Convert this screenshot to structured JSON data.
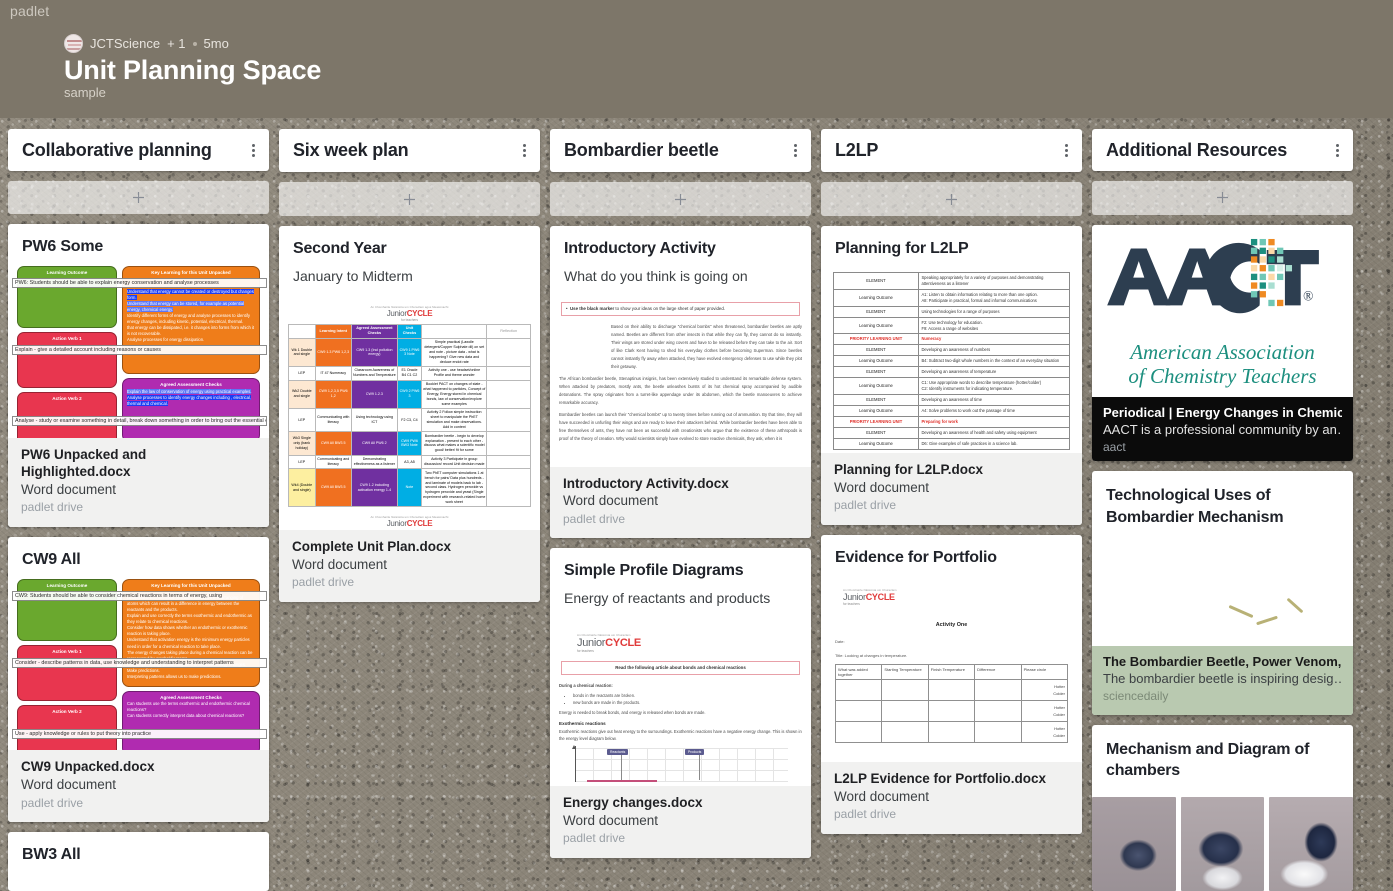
{
  "brand": "padlet",
  "header": {
    "author": "JCTScience",
    "collaborators": "+ 1",
    "age": "5mo",
    "title": "Unit Planning Space",
    "subtitle": "sample",
    "avatar_icon": "avatar-icon"
  },
  "add_icon": "plus-icon",
  "kebab_icon": "more-options-icon",
  "columns": [
    {
      "title": "Collaborative planning",
      "cards": [
        {
          "subject": "PW6 Some",
          "attachment": {
            "name": "PW6 Unpacked and Highlighted.docx",
            "type": "Word document",
            "source": "padlet drive"
          },
          "preview": {
            "kind": "unpacked",
            "learning_outcome_header": "Learning Outcome",
            "key_learning_header": "Key Learning for this Unit Unpacked",
            "action_verb_1_header": "Action Verb 1",
            "action_verb_2_header": "Action Verb 2",
            "assessment_header": "Agreed Assessment Checks",
            "outcome_line": "PW6: Students should be able to explain energy conservation and analyse processes",
            "verb1_line": "Explain - give a detailed account including reasons or causes",
            "verb2_line": "Analyse - study or examine something in detail, break down something in order to bring out the essential elements",
            "key_points": [
              "Understand that energy cannot be created or destroyed but changes form.",
              "Understand that energy can be stored, for example as potential energy, chemical energy.",
              "Identify different forms of energy and analyse processes to identify energy changes, including kinetic, potential, electrical, thermal.",
              "that energy can be dissipated, i.e. it changes into forms from which it is not recoverable.",
              "Analyse processes for energy dissipation."
            ],
            "assessment_points": [
              "Explain the law of conservation of energy using practical examples.",
              "Analyse processes to identify energy changes including , electrical, thermal and chemical."
            ]
          }
        },
        {
          "subject": "CW9 All",
          "attachment": {
            "name": "CW9 Unpacked.docx",
            "type": "Word document",
            "source": "padlet drive"
          },
          "preview": {
            "kind": "unpacked",
            "learning_outcome_header": "Learning Outcome",
            "key_learning_header": "Key Learning for this Unit Unpacked",
            "action_verb_1_header": "Action Verb 1",
            "action_verb_2_header": "Action Verb 2",
            "assessment_header": "Agreed Assessment Checks",
            "outcome_line": "CW9: Students should be able to consider chemical reactions in terms of energy, using",
            "verb1_line": "Consider - describe patterns in data, use knowledge and understanding to interpret patterns",
            "verb2_line": "Use - apply knowledge or rules to put theory into practice",
            "key_points": [
              "Understand that chemical reactions involves the rearranging of atoms which can result in a difference in energy between the reactants and the products.",
              "Explain and use correctly the terms exothermic and endothermic as they relate to chemical reactions.",
              "Consider how data shows whether an endothermic or exothermic reaction is taking place.",
              "Understand that activation energy is the minimum energy particles need in order for a chemical reaction to take place.",
              "The energy changes taking place during a chemical reaction can be represented by graphs/diagrams.",
              "Use simple energy profile diagrams to illustrate energy changes.",
              "Make predictions.",
              "Interpreting patterns allows us to make predictions."
            ],
            "assessment_points": [
              "Can students use the terms exothermic and endothermic chemical reactions?",
              "Can students correctly interpret data about chemical reactions?"
            ]
          }
        },
        {
          "subject": "BW3 All",
          "attachment": null,
          "preview": {
            "kind": "none"
          }
        }
      ]
    },
    {
      "title": "Six week plan",
      "cards": [
        {
          "subject": "Second Year",
          "body": "January to Midterm",
          "attachment": {
            "name": "Complete Unit Plan.docx",
            "type": "Word document",
            "source": "padlet drive"
          },
          "preview": {
            "kind": "unit-plan-table",
            "logo_caption": "An Chomhairle Náisiúnta um Churaclam agus Measúnacht",
            "logo_mark_a": "Junior",
            "logo_mark_b": "CYCLE",
            "logo_sub": "for teachers",
            "headers": [
              "",
              "Learning Intent",
              "Agreed Assessment Checks",
              "Unit Checks",
              "",
              "Reflection"
            ],
            "rows": [
              [
                "Wk 1 Double and single",
                "CW9 1.3 PW6 1,2,3",
                "CW9 1.3 (Incl pollution energy)",
                "CW9 1 PW6 3 Note",
                "Simple practical (Lawdle detergent/Copper Sulphate dil) on set and note - picture data - what is happening? Give new data and deduce endot rate",
                ""
              ],
              [
                "LEP",
                "IT 47 Numeracy",
                "Classroom Awareness of Numbers and Temperature",
                "E1 Oracle B4 C1 C2",
                "Activity one - use headset/online Profile and theme wonder",
                ""
              ],
              [
                "Wk2 Double and single",
                "CW9 1,2,3,5 PW6 1,2",
                "CW9 1.2.3",
                "CW9 2 PW6 3",
                "Booklet PACT on changes of state - what happened to particles, Concept of Energy, Energy stored in chemical bonds, law of conservation/explore some examples",
                ""
              ],
              [
                "LEP",
                "Communicating with literacy",
                "Using technology using ICT",
                "F2 C3, C4",
                "Activity 2 Follow simple instruction sheet to manipulate the PhET simulation and make observations. Add in context",
                ""
              ],
              [
                "Wk3 Single only (bank holiday)",
                "CW9 All BW3 5",
                "CW9 All PW6 2",
                "CW9 PW6 BW3 Note",
                "Bombardier beetle - begin to develop explanation - present to each other - discuss what makes a scientific model good/ better/ fit for some",
                ""
              ],
              [
                "LEP",
                "Communicating and literacy",
                "Demonstrating effectiveness as a listener",
                "A3, A5",
                "Activity 3 Participate in group discussion/ record Unit decision made",
                ""
              ],
              [
                "Wk4 (Double and single)",
                "CW9 All BW3 5",
                "CW9 1.2 including activation energy 1-4",
                "Note",
                "Two PhET computer simulations 1 at bench for pairs/ Data plus hundreds - and laminate of models back to lab - second class. Hydrogen peroxide vs hydrogen peroxide and yeast (Single experiment with research-related home work sheet",
                ""
              ]
            ],
            "footer_mark_a": "Junior",
            "footer_mark_b": "CYCLE"
          }
        }
      ]
    },
    {
      "title": "Bombardier beetle",
      "cards": [
        {
          "subject": "Introductory Activity",
          "body": "What do you think is going on",
          "attachment": {
            "name": "Introductory Activity.docx",
            "type": "Word document",
            "source": "padlet drive"
          },
          "preview": {
            "kind": "article",
            "callout_bold": "Use the black marker",
            "callout_rest": " to show your ideas on the large sheet of paper provided.",
            "paragraphs": [
              "Based on their ability to discharge \"chemical bombs\" when threatened, bombardier beetles are aptly named.  Beetles are different from other insects in that while they can fly, they cannot do so instantly.  Their wings are stored under wing covers and have to be released before they can take to the air.  Sort of like Clark Kent having to shed his everyday clothes before becoming Superman.  Since beetles cannot instantly fly away when attacked, they have evolved emergency defenses to use while they plot their getaway.",
              "The African bombardier beetle, Stenaptinus insignis, has been extensively studied to understand its remarkable defense system.  When attacked by predators, mostly ants, the beetle unleashes bursts of its hot chemical spray accompanied by audible detonations.  The spray originates from a turret-like appendage under its abdomen, which the beetle manoeuvres to achieve remarkable accuracy.",
              "Bombardier beetles can launch their \"chemical bombs\" up to twenty times before running out of ammunition.  By that time, they will have succeeded in unfurling their wings and are ready to leave their attackers behind.  While bombardier beetles have been able to free themselves of ants, they have not been as successful with creationists who argue that the existence of these arthropods is proof of the theory of creation.  Why would scientists simply have evolved to store reactive chemicals, they ask, when it is"
            ]
          }
        },
        {
          "subject": "Simple Profile Diagrams",
          "body": "Energy of reactants and products",
          "attachment": {
            "name": "Energy changes.docx",
            "type": "Word document",
            "source": "padlet drive"
          },
          "preview": {
            "kind": "energy-changes",
            "logo_caption": "An Chomhairle Náisiúnta um Churaclam",
            "logo_mark_a": "Junior",
            "logo_mark_b": "CYCLE",
            "logo_sub": "for teachers",
            "banner": "Read the following article about bonds and chemical reactions",
            "lead": "During a chemical reaction:",
            "bullets": [
              "bonds in the reactants are broken.",
              "new bonds are made in the products."
            ],
            "note": "Energy is needed to break bonds, and energy is released when bonds are made.",
            "section_title": "Exothermic reactions",
            "section_text": "Exothermic reactions give out heat energy to the surroundings.  Exothermic reactions have a negative energy change.  This is shown in the energy level diagram below.",
            "chart_labels": {
              "reactants": "Reactants",
              "products": "Products"
            }
          }
        }
      ]
    },
    {
      "title": "L2LP",
      "cards": [
        {
          "subject": "Planning for L2LP",
          "attachment": {
            "name": "Planning for L2LP.docx",
            "type": "Word document",
            "source": "padlet drive"
          },
          "preview": {
            "kind": "l2lp-table",
            "rows": [
              {
                "label": "ELEMENT",
                "value": "Speaking appropriately for a variety of purposes and demonstrating attentiveness as a listener",
                "style": "plain"
              },
              {
                "label": "Learning Outcome",
                "value": "A1:  Listen to obtain information relating to more than one option.\nA8:  Participate in practical, formal and informal communications",
                "style": "plain"
              },
              {
                "label": "ELEMENT",
                "value": "Using technologies for a range of purposes",
                "style": "plain"
              },
              {
                "label": "Learning Outcome",
                "value": "F2:  Use technology for education.\nF9:  Access a range of websites",
                "style": "plain"
              },
              {
                "label": "PRIORITY LEARNING UNIT",
                "value": "Numeracy",
                "style": "plu"
              },
              {
                "label": "ELEMENT",
                "value": "Developing an awareness of numbers",
                "style": "plain"
              },
              {
                "label": "Learning Outcome",
                "value": "B4:  Subtract two-digit whole numbers in the context of an everyday situation",
                "style": "plain"
              },
              {
                "label": "ELEMENT",
                "value": "Developing an awareness of temperature",
                "style": "plain"
              },
              {
                "label": "Learning Outcome",
                "value": "C1:  Use appropriate words to describe temperature (hotter/colder)\nC2:  Identify instruments for indicating temperature.",
                "style": "plain"
              },
              {
                "label": "ELEMENT",
                "value": "Developing an awareness of time",
                "style": "plain"
              },
              {
                "label": "Learning Outcome",
                "value": "A4:  Solve problems to work out the passage of time",
                "style": "plain"
              },
              {
                "label": "PRIORITY LEARNING UNIT",
                "value": "Preparing for work",
                "style": "plu"
              },
              {
                "label": "ELEMENT",
                "value": "Developing an awareness of health and safety using equipment",
                "style": "plain"
              },
              {
                "label": "Learning Outcome",
                "value": "D6:  Give examples of safe practices in a science lab.",
                "style": "plain"
              }
            ]
          }
        },
        {
          "subject": "Evidence for Portfolio",
          "attachment": {
            "name": "L2LP Evidence for Portfolio.docx",
            "type": "Word document",
            "source": "padlet drive"
          },
          "preview": {
            "kind": "portfolio",
            "logo_caption": "An Chomhairle Náisiúnta um Churaclam",
            "logo_mark_a": "Junior",
            "logo_mark_b": "CYCLE",
            "logo_sub": "for teachers",
            "heading": "Activity One",
            "date_label": "Date:",
            "title_line": "Title: Looking at changes in temperature.",
            "columns": [
              "What was added together",
              "Starting Temperature",
              "Finish Temperature",
              "Difference",
              "Please circle"
            ],
            "circle_options": [
              "Hotter",
              "Colder"
            ],
            "row_count": 3
          }
        }
      ]
    },
    {
      "title": "Additional Resources",
      "cards": [
        {
          "subject": null,
          "preview": {
            "kind": "aact-logo",
            "logo_text": "AACT",
            "registered_mark": "®",
            "line1": "American Association",
            "line2": "of Chemistry Teachers"
          },
          "link": {
            "title": "Periodical | Energy Changes in Chemical…",
            "description": "AACT is a professional community by an…",
            "source": "aact",
            "theme": "dark"
          }
        },
        {
          "subject": "Technological Uses of Bombardier Mechanism",
          "preview": {
            "kind": "beetle-photo"
          },
          "link": {
            "title": "The Bombardier Beetle, Power Venom, A…",
            "description": "The bombardier beetle is inspiring desig…",
            "source": "sciencedaily",
            "theme": "sage"
          }
        },
        {
          "subject": "Mechanism and Diagram of chambers",
          "preview": {
            "kind": "mechanism-photos"
          }
        }
      ]
    }
  ],
  "colors": {
    "board_background": "#8d8679",
    "header_bar": "#7d7669",
    "card_surface": "#ffffff",
    "attachment_footer": "#f1f1f0",
    "link_footer_dark": "#0b0b0b",
    "link_footer_sage": "#b9c9b0",
    "unpacked_green": "#6aa82e",
    "unpacked_red": "#e8364f",
    "unpacked_orange": "#ef7d1a",
    "unpacked_purple": "#b02bb0",
    "plan_orange": "#f07020",
    "plan_purple": "#7030a0",
    "plan_cyan": "#00aee4",
    "aact_navy": "#2d3e50",
    "aact_teal": "#1c8f7f"
  }
}
